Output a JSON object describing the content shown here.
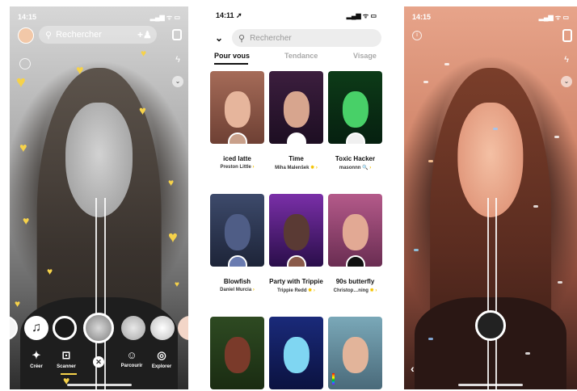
{
  "left": {
    "status_time": "14:15",
    "status_icons": "▂▄▆ ᯤ ▭",
    "search_placeholder": "Rechercher",
    "icons": [
      "avatar",
      "add-friend-icon",
      "rotate-camera-icon",
      "flash-icon",
      "chevron-down-icon",
      "heart-icon"
    ],
    "nav": [
      {
        "label": "Créer",
        "icon": "magic-wand-icon",
        "glyph": "✦"
      },
      {
        "label": "Scanner",
        "icon": "scan-icon",
        "glyph": "⊡"
      },
      {
        "label": "Parcourir",
        "icon": "smile-icon",
        "glyph": "☺"
      },
      {
        "label": "Explorer",
        "icon": "compass-icon",
        "glyph": "◎"
      }
    ],
    "close_glyph": "✕",
    "music_glyph": "♫",
    "accent": "#f6d24a"
  },
  "middle": {
    "status_time": "14:11 ➚",
    "status_icons": "▂▄▆ ᯤ ▭",
    "search_placeholder": "Rechercher",
    "tabs": [
      {
        "label": "Pour vous",
        "active": true
      },
      {
        "label": "Tendance",
        "active": false
      },
      {
        "label": "Visage",
        "active": false
      }
    ],
    "lenses": [
      {
        "title": "iced latte",
        "creator": "Preston Little",
        "badge": "›"
      },
      {
        "title": "Time",
        "creator": "Miha Malenšek",
        "badge": "✸ ›"
      },
      {
        "title": "Toxic Hacker",
        "creator": "masonnn",
        "badge": "🔍 ›"
      },
      {
        "title": "Blowfish",
        "creator": "Daniel Murcia",
        "badge": "›"
      },
      {
        "title": "Party with Trippie",
        "creator": "Trippie Redd",
        "badge": "✸ ›"
      },
      {
        "title": "90s butterfly",
        "creator": "Christop…ning",
        "badge": "✸ ›"
      },
      {
        "title": "",
        "creator": "",
        "badge": ""
      },
      {
        "title": "",
        "creator": "",
        "badge": ""
      },
      {
        "title": "",
        "creator": "",
        "badge": ""
      }
    ]
  },
  "right": {
    "status_time": "14:15",
    "status_icons": "▂▄▆ ᯤ ▭",
    "info_glyph": "i",
    "back_glyph": "‹"
  }
}
